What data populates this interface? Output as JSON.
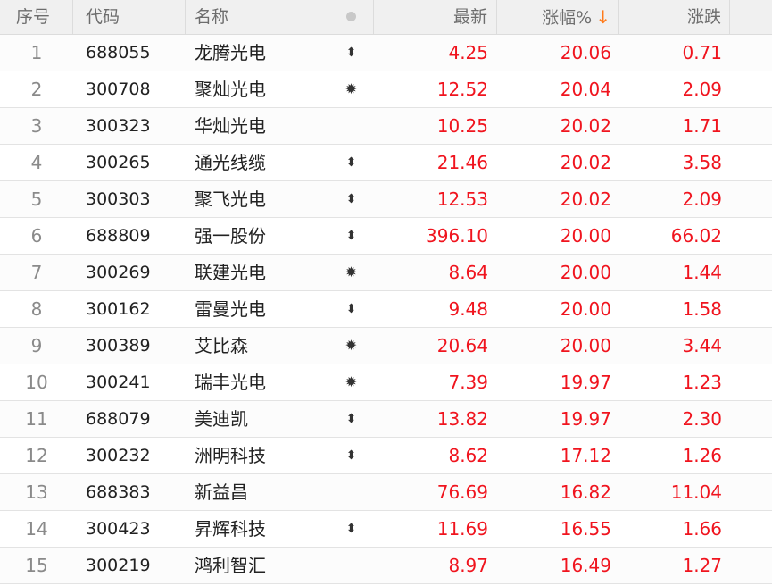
{
  "header": {
    "seq": "序号",
    "code": "代码",
    "name": "名称",
    "last": "最新",
    "pct": "涨幅%",
    "pct_sort": "↓",
    "chg": "涨跌"
  },
  "rows": [
    {
      "seq": "1",
      "code": "688055",
      "name": "龙腾光电",
      "mark": "⬍",
      "mark_type": "updown",
      "last": "4.25",
      "pct": "20.06",
      "chg": "0.71"
    },
    {
      "seq": "2",
      "code": "300708",
      "name": "聚灿光电",
      "mark": "✹",
      "mark_type": "star",
      "last": "12.52",
      "pct": "20.04",
      "chg": "2.09"
    },
    {
      "seq": "3",
      "code": "300323",
      "name": "华灿光电",
      "mark": "",
      "mark_type": "none",
      "last": "10.25",
      "pct": "20.02",
      "chg": "1.71"
    },
    {
      "seq": "4",
      "code": "300265",
      "name": "通光线缆",
      "mark": "⬍",
      "mark_type": "updown",
      "last": "21.46",
      "pct": "20.02",
      "chg": "3.58"
    },
    {
      "seq": "5",
      "code": "300303",
      "name": "聚飞光电",
      "mark": "⬍",
      "mark_type": "updown",
      "last": "12.53",
      "pct": "20.02",
      "chg": "2.09"
    },
    {
      "seq": "6",
      "code": "688809",
      "name": "强一股份",
      "mark": "⬍",
      "mark_type": "updown",
      "last": "396.10",
      "pct": "20.00",
      "chg": "66.02"
    },
    {
      "seq": "7",
      "code": "300269",
      "name": "联建光电",
      "mark": "✹",
      "mark_type": "star",
      "last": "8.64",
      "pct": "20.00",
      "chg": "1.44"
    },
    {
      "seq": "8",
      "code": "300162",
      "name": "雷曼光电",
      "mark": "⬍",
      "mark_type": "updown",
      "last": "9.48",
      "pct": "20.00",
      "chg": "1.58"
    },
    {
      "seq": "9",
      "code": "300389",
      "name": "艾比森",
      "mark": "✹",
      "mark_type": "star",
      "last": "20.64",
      "pct": "20.00",
      "chg": "3.44"
    },
    {
      "seq": "10",
      "code": "300241",
      "name": "瑞丰光电",
      "mark": "✹",
      "mark_type": "star",
      "last": "7.39",
      "pct": "19.97",
      "chg": "1.23"
    },
    {
      "seq": "11",
      "code": "688079",
      "name": "美迪凯",
      "mark": "⬍",
      "mark_type": "updown",
      "last": "13.82",
      "pct": "19.97",
      "chg": "2.30"
    },
    {
      "seq": "12",
      "code": "300232",
      "name": "洲明科技",
      "mark": "⬍",
      "mark_type": "updown",
      "last": "8.62",
      "pct": "17.12",
      "chg": "1.26"
    },
    {
      "seq": "13",
      "code": "688383",
      "name": "新益昌",
      "mark": "",
      "mark_type": "none",
      "last": "76.69",
      "pct": "16.82",
      "chg": "11.04"
    },
    {
      "seq": "14",
      "code": "300423",
      "name": "昇辉科技",
      "mark": "⬍",
      "mark_type": "updown",
      "last": "11.69",
      "pct": "16.55",
      "chg": "1.66"
    },
    {
      "seq": "15",
      "code": "300219",
      "name": "鸿利智汇",
      "mark": "",
      "mark_type": "none",
      "last": "8.97",
      "pct": "16.49",
      "chg": "1.27"
    }
  ],
  "colors": {
    "up": "#f0141e",
    "sort_arrow": "#ff7a1a",
    "header_bg": "#f0f0f0"
  }
}
